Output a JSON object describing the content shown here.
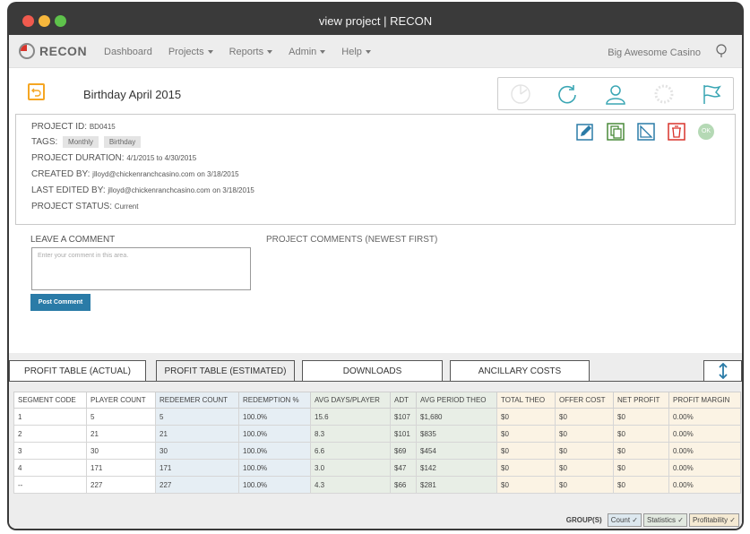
{
  "window": {
    "title": "view project | RECON"
  },
  "nav": {
    "logo": "RECON",
    "items": [
      {
        "label": "Dashboard",
        "dropdown": false
      },
      {
        "label": "Projects",
        "dropdown": true
      },
      {
        "label": "Reports",
        "dropdown": true
      },
      {
        "label": "Admin",
        "dropdown": true
      },
      {
        "label": "Help",
        "dropdown": true
      }
    ],
    "org": "Big Awesome Casino"
  },
  "project": {
    "title": "Birthday April 2015",
    "id_label": "PROJECT ID:",
    "id_value": "BD0415",
    "tags_label": "TAGS:",
    "tags": [
      "Monthly",
      "Birthday"
    ],
    "duration_label": "PROJECT DURATION:",
    "duration_value": "4/1/2015 to 4/30/2015",
    "created_label": "CREATED BY:",
    "created_by": "jlloyd@chickenranchcasino.com",
    "created_on": "on 3/18/2015",
    "edited_label": "LAST EDITED BY:",
    "edited_by": "jlloyd@chickenranchcasino.com",
    "edited_on": "on 3/18/2015",
    "status_label": "PROJECT STATUS:",
    "status_value": "Current",
    "ok_badge": "OK"
  },
  "comments": {
    "leave_label": "LEAVE A COMMENT",
    "placeholder": "Enter your comment in this area.",
    "post_button": "Post Comment",
    "list_label": "PROJECT COMMENTS (NEWEST FIRST)"
  },
  "tabs": [
    {
      "label": "PROFIT TABLE (ACTUAL)",
      "active": false
    },
    {
      "label": "PROFIT TABLE (ESTIMATED)",
      "active": true
    },
    {
      "label": "DOWNLOADS",
      "active": false
    },
    {
      "label": "ANCILLARY COSTS",
      "active": false
    }
  ],
  "table": {
    "headers": [
      "SEGMENT CODE",
      "PLAYER COUNT",
      "REDEEMER COUNT",
      "REDEMPTION %",
      "AVG DAYS/PLAYER",
      "ADT",
      "AVG PERIOD THEO",
      "TOTAL THEO",
      "OFFER COST",
      "NET PROFIT",
      "PROFIT MARGIN"
    ],
    "rows": [
      [
        "1",
        "5",
        "5",
        "100.0%",
        "15.6",
        "$107",
        "$1,680",
        "$0",
        "$0",
        "$0",
        "0.00%"
      ],
      [
        "2",
        "21",
        "21",
        "100.0%",
        "8.3",
        "$101",
        "$835",
        "$0",
        "$0",
        "$0",
        "0.00%"
      ],
      [
        "3",
        "30",
        "30",
        "100.0%",
        "6.6",
        "$69",
        "$454",
        "$0",
        "$0",
        "$0",
        "0.00%"
      ],
      [
        "4",
        "171",
        "171",
        "100.0%",
        "3.0",
        "$47",
        "$142",
        "$0",
        "$0",
        "$0",
        "0.00%"
      ],
      [
        "--",
        "227",
        "227",
        "100.0%",
        "4.3",
        "$66",
        "$281",
        "$0",
        "$0",
        "$0",
        "0.00%"
      ]
    ]
  },
  "footer": {
    "groups_label": "GROUP(S)",
    "chips": [
      "Count ✓",
      "Statistics ✓",
      "Profitability ✓"
    ]
  },
  "colors": {
    "accent_blue": "#2a7ba7",
    "teal": "#3aa6b4",
    "green": "#4a8a3a",
    "red": "#d9342b",
    "orange": "#f5a623"
  }
}
